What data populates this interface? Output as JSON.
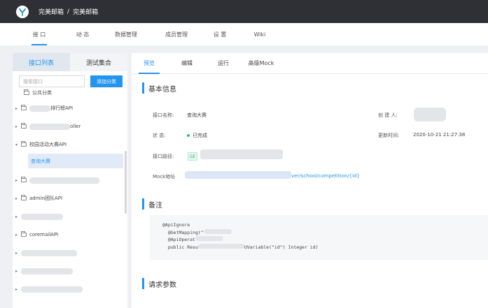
{
  "app": {
    "breadcrumb": [
      "完美邮箱",
      "完美邮箱"
    ],
    "breadcrumb_sep": "/"
  },
  "nav": {
    "items": [
      {
        "label": "接 口",
        "active": true
      },
      {
        "label": "动 态",
        "active": false
      },
      {
        "label": "数据管理",
        "active": false
      },
      {
        "label": "成员管理",
        "active": false
      },
      {
        "label": "设 置",
        "active": false
      },
      {
        "label": "Wiki",
        "active": false
      }
    ]
  },
  "sidebar": {
    "tabs": [
      {
        "label": "接口列表",
        "active": true
      },
      {
        "label": "测试集合",
        "active": false
      }
    ],
    "search_placeholder": "搜索接口",
    "add_button": "添加分类",
    "tree": [
      {
        "label": "公共分类",
        "expandable": false
      },
      {
        "label": "排行榜API",
        "expandable": true
      },
      {
        "label": "oller",
        "expandable": true
      },
      {
        "label": "校园活动大赛API",
        "expandable": true,
        "expanded": true
      },
      {
        "label": "查询大赛",
        "child": true,
        "selected": true
      },
      {
        "label": "",
        "expandable": true
      },
      {
        "label": "admin团队API",
        "expandable": true
      },
      {
        "label": "",
        "expandable": true
      },
      {
        "label": "coremailAPI",
        "expandable": true
      },
      {
        "label": "",
        "expandable": true
      },
      {
        "label": "",
        "expandable": true
      },
      {
        "label": "",
        "expandable": true
      }
    ]
  },
  "content": {
    "tabs": [
      {
        "label": "预览",
        "active": true
      },
      {
        "label": "编辑",
        "active": false
      },
      {
        "label": "运行",
        "active": false
      },
      {
        "label": "高级Mock",
        "active": false
      }
    ],
    "basic_info_title": "基本信息",
    "fields": {
      "name_label": "接口名称:",
      "name_value": "查询大赛",
      "creator_label": "创 建 人:",
      "status_label": "状 态:",
      "status_value": "已完成",
      "updated_label": "更新时间:",
      "updated_value": "2020-10-21 21:27:38",
      "path_label": "接口路径:",
      "method": "GE",
      "mock_label": "Mock地址",
      "mock_url_tail": "ver/school/competition/{id}"
    },
    "remark_title": "备注",
    "remark_lines": [
      "@ApiIgnore",
      "  @GetMapping(\"",
      "  @ApiOperat",
      "  public Resu",
      "UVariable(\"id\") Integer id)"
    ],
    "request_params_title": "请求参数"
  },
  "colors": {
    "accent": "#2395f1",
    "topbar": "#2f3035",
    "success": "#2ec17c"
  }
}
